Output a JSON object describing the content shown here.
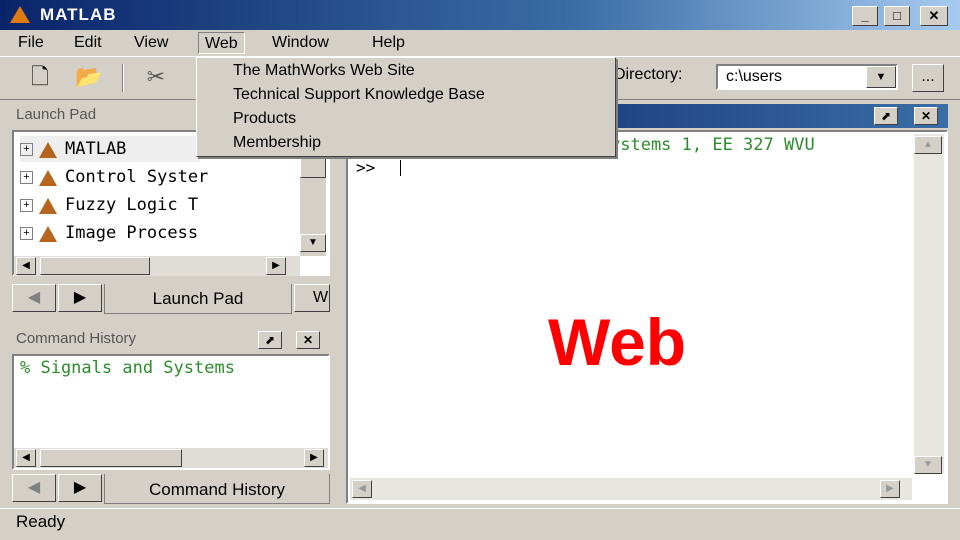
{
  "window": {
    "title": "MATLAB",
    "minimize": "_",
    "maximize": "□",
    "close": "✕"
  },
  "menu": [
    "File",
    "Edit",
    "View",
    "Web",
    "Window",
    "Help"
  ],
  "web_menu": [
    "The MathWorks Web Site",
    "Technical Support Knowledge Base",
    "Products",
    "Membership"
  ],
  "toolbar": {
    "directory_label": "Directory:",
    "directory_value": "c:\\users",
    "browse": "..."
  },
  "launch_pad": {
    "title": "Launch Pad",
    "items": [
      "MATLAB",
      "Control Syster",
      "Fuzzy Logic T",
      "Image Process"
    ],
    "tab_label": "Launch Pad",
    "second_tab": "W"
  },
  "command_history": {
    "title": "Command History",
    "line": "% Signals and Systems",
    "tab_label": "Command History"
  },
  "command_window": {
    "header": "ystems 1, EE 327 WVU",
    "prompt": ">>"
  },
  "overlay_label": "Web",
  "status": "Ready",
  "colors": {
    "titlebar": "#0a246a",
    "chrome": "#d4d0c8",
    "history_text": "#2e8b2e",
    "overlay": "#ff0000"
  }
}
